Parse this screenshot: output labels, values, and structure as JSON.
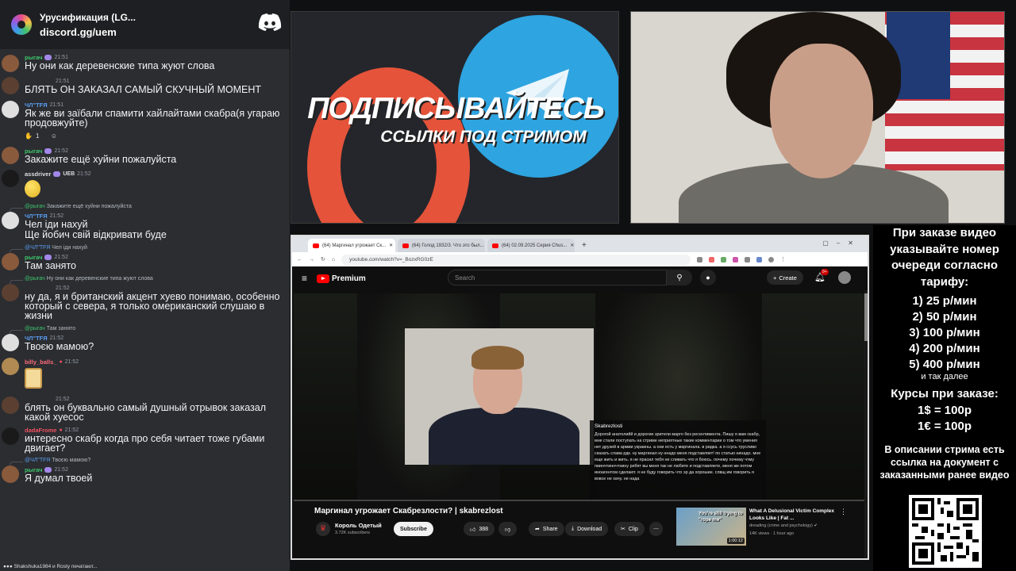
{
  "chat": {
    "server_name": "Урусификация (LG...",
    "invite": "discord.gg/uem",
    "messages": [
      {
        "user": "рыгач",
        "time": "21:51",
        "text": "Ну они как деревенские типа жуют слова"
      },
      {
        "user": "",
        "time": "21:51",
        "text": "БЛЯТЬ ОН ЗАКАЗАЛ САМЫЙ СКУЧНЫЙ МОМЕНТ"
      },
      {
        "user": "ЧЛ\"ТFЯ",
        "time": "21:51",
        "text": "Як же ви заїбали спамити хайлайтами скабра(я угараю продовжуйте)",
        "reaction_count": "1"
      },
      {
        "user": "рыгач",
        "time": "21:52",
        "text": "Закажите ещё хуйни пожалуйста"
      },
      {
        "user": "assdriver",
        "tag": "UEB",
        "time": "21:52",
        "text": ""
      },
      {
        "reply_user": "@рыгач",
        "reply_text": "Закажите ещё хуйни пожалуйста",
        "user": "ЧЛ\"ТFЯ",
        "time": "21:52",
        "text": "Чел іди нахуй\nЩе йобич свій відкривати буде"
      },
      {
        "reply_user": "@ЧЛ\"ТFЯ",
        "reply_text": "Чел іди нахуй",
        "user": "рыгач",
        "time": "21:52",
        "text": "Там занято"
      },
      {
        "reply_user": "@рыгач",
        "reply_text": "Ну они как деревенские типа жуют слова",
        "user": "",
        "time": "21:52",
        "text": "ну да, я и британский акцент хуево понимаю, особенно который с севера, я только омериканский слушаю в жизни"
      },
      {
        "reply_user": "@рыгач",
        "reply_text": "Там занято",
        "user": "ЧЛ\"ТFЯ",
        "time": "21:52",
        "text": "Твоєю мамою?"
      },
      {
        "user": "billy_balls_",
        "time": "21:52",
        "text": ""
      },
      {
        "user": "",
        "time": "21:52",
        "text": "блять он буквально самый душный отрывок заказал какой хуесос"
      },
      {
        "user": "dadaFrome",
        "time": "21:52",
        "text": "интересно скабр когда про себя читает тоже губами двигает?"
      },
      {
        "reply_user": "@ЧЛ\"ТFЯ",
        "reply_text": "Твоєю мамою?",
        "user": "рыгач",
        "time": "21:52",
        "text": "Я думал твоей"
      }
    ],
    "typing": "Shakshuka1984 и Rosty печатают..."
  },
  "promo": {
    "line1": "ПОДПИСЫВАЙТЕСЬ",
    "line2": "ССЫЛКИ ПОД СТРИМОМ"
  },
  "browser": {
    "tabs": [
      {
        "label": "(64) Маргинал угрожает Ск..."
      },
      {
        "label": "(64) Голод 1932/3. Что это был..."
      },
      {
        "label": "(64) 02.09.2025 Серия Chus..."
      }
    ],
    "url": "youtube.com/watch?v=_BozxRG0zE",
    "yt": {
      "brand": "Premium",
      "search_placeholder": "Search",
      "create_label": "Create",
      "notif_count": "9+",
      "video_title": "Маргинал угрожает Скабрезлости? | skabrezlost",
      "channel": "Король Одетый",
      "subscribers": "3.72K subscribers",
      "subscribe_label": "Subscribe",
      "likes": "388",
      "share_label": "Share",
      "download_label": "Download",
      "clip_label": "Clip",
      "donation": {
        "name": "Skabrezlosti",
        "text": "Дорогой анатолийй и дорогие зрители марго без ресентимента. Пишу я вам скабр, мне стали поступать на стриме неприятные такие комментарии о том что умения нет друзей в армии украины. а они есть у маргинала. в ридка. а я ссусь трусливо сказать слава рдк. ну маргинал ну ннадо меня подставляет! по статью нинадо. мне еще жить и жить. я не прасил тебя не сливать что я боюсь. почему почему чтму пиинчтиннчтнину ребят вы меня так не любите и подставляете, меня же потом иноагентом сделают. я не буду говорить что эр да хорошие. слвщ им говорить я вовсе не хачу. не нада"
      },
      "recommended": {
        "thumb_text": "You're still trying to \"rope me\"",
        "duration": "1:00:12",
        "title": "What A Delusional Victim Complex Looks Like | Fat ...",
        "channel": "dreading (crime and psychology)",
        "stats": "14K views · 1 hour ago"
      }
    }
  },
  "info": {
    "header": "При заказе видео указывайте номер очереди согласно тарифу:",
    "tariffs": [
      "1) 25 р/мин",
      "2) 50 р/мин",
      "3) 100 р/мин",
      "4) 200 р/мин",
      "5) 400 р/мин"
    ],
    "tariff_note": "и так далее",
    "rates_header": "Курсы при заказе:",
    "rates": [
      "1$ = 100р",
      "1€ = 100р"
    ],
    "footer": "В описании стрима есть ссылка на документ с заказанными ранее видео"
  }
}
